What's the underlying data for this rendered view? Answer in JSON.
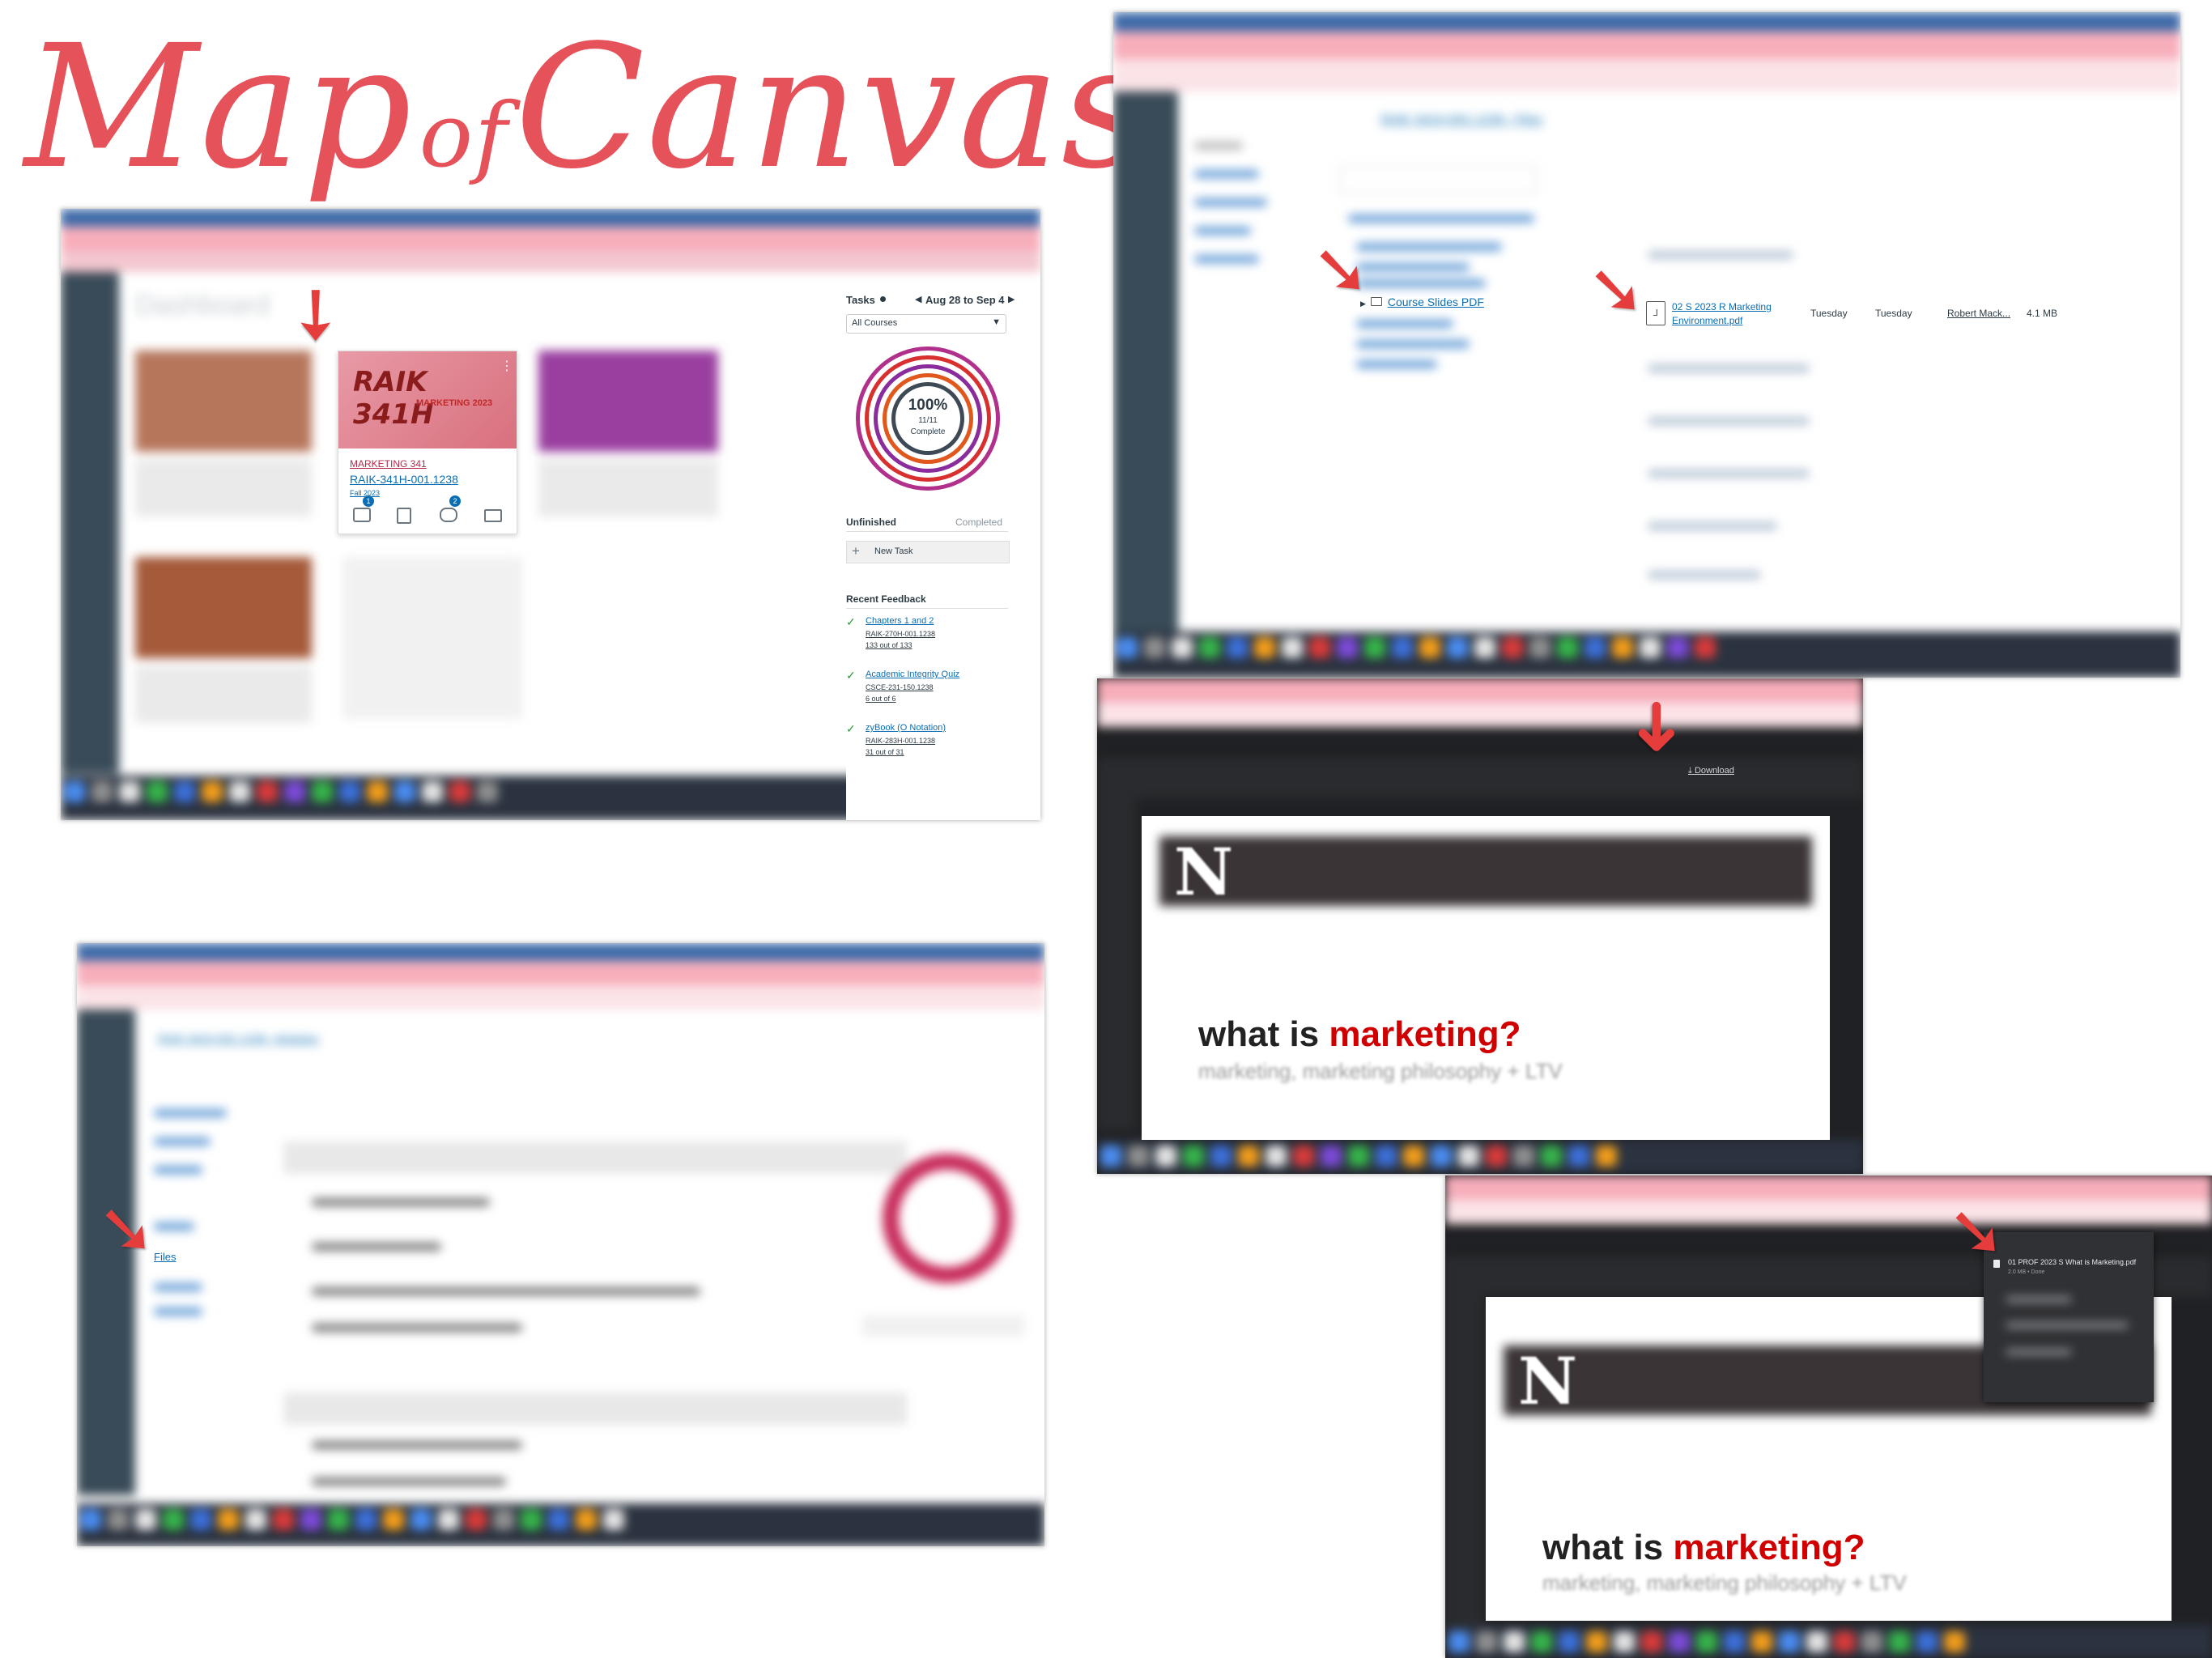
{
  "title": {
    "word1": "Map",
    "word2": "of",
    "word3": "Canvas"
  },
  "colors": {
    "accent": "#e5525a",
    "arrow": "#e53c3c",
    "canvas_link": "#0b6eb3",
    "nebraska_red": "#d00000"
  },
  "panel1": {
    "course_card": {
      "banner_text": "RAIK 341H",
      "banner_subtext": "MARKETING 2023",
      "course_name": "MARKETING 341",
      "course_code": "RAIK-341H-001.1238",
      "term": "Fall 2023",
      "badge_1": "1",
      "badge_2": "2",
      "menu_glyph": "⋮"
    },
    "tasks": {
      "header": "Tasks",
      "date_range": "Aug 28 to Sep 4",
      "filter": "All Courses",
      "percent": "100%",
      "fraction": "11/11",
      "complete": "Complete",
      "tab_unfinished": "Unfinished",
      "tab_completed": "Completed",
      "new_task": "New Task"
    },
    "recent_feedback": {
      "header": "Recent Feedback",
      "items": [
        {
          "title": "Chapters 1 and 2",
          "course": "RAIK-270H-001.1238",
          "score": "133 out of 133"
        },
        {
          "title": "Academic Integrity Quiz",
          "course": "CSCE-231-150.1238",
          "score": "6 out of 6"
        },
        {
          "title": "zyBook (O Notation)",
          "course": "RAIK-283H-001.1238",
          "score": "31 out of 31"
        }
      ]
    }
  },
  "panel2": {
    "folder": "Course Slides PDF",
    "file": {
      "name_line1": "02 S 2023 R Marketing",
      "name_line2": "Environment.pdf",
      "created": "Tuesday",
      "modified": "Tuesday",
      "modified_by": "Robert Mack...",
      "size": "4.1 MB"
    }
  },
  "panel3": {
    "download_label": "Download",
    "slide_title_black": "what is",
    "slide_title_red": "marketing?",
    "slide_subtitle": "marketing, marketing philosophy + LTV",
    "logo_letter": "N"
  },
  "panel4": {
    "sidebar_files": "Files"
  },
  "panel5": {
    "download_item_name": "01 PROF 2023 S What is Marketing.pdf",
    "download_item_status": "2.0 MB • Done",
    "slide_title_black": "what is",
    "slide_title_red": "marketing?",
    "slide_subtitle": "marketing, marketing philosophy + LTV",
    "logo_letter": "N"
  }
}
